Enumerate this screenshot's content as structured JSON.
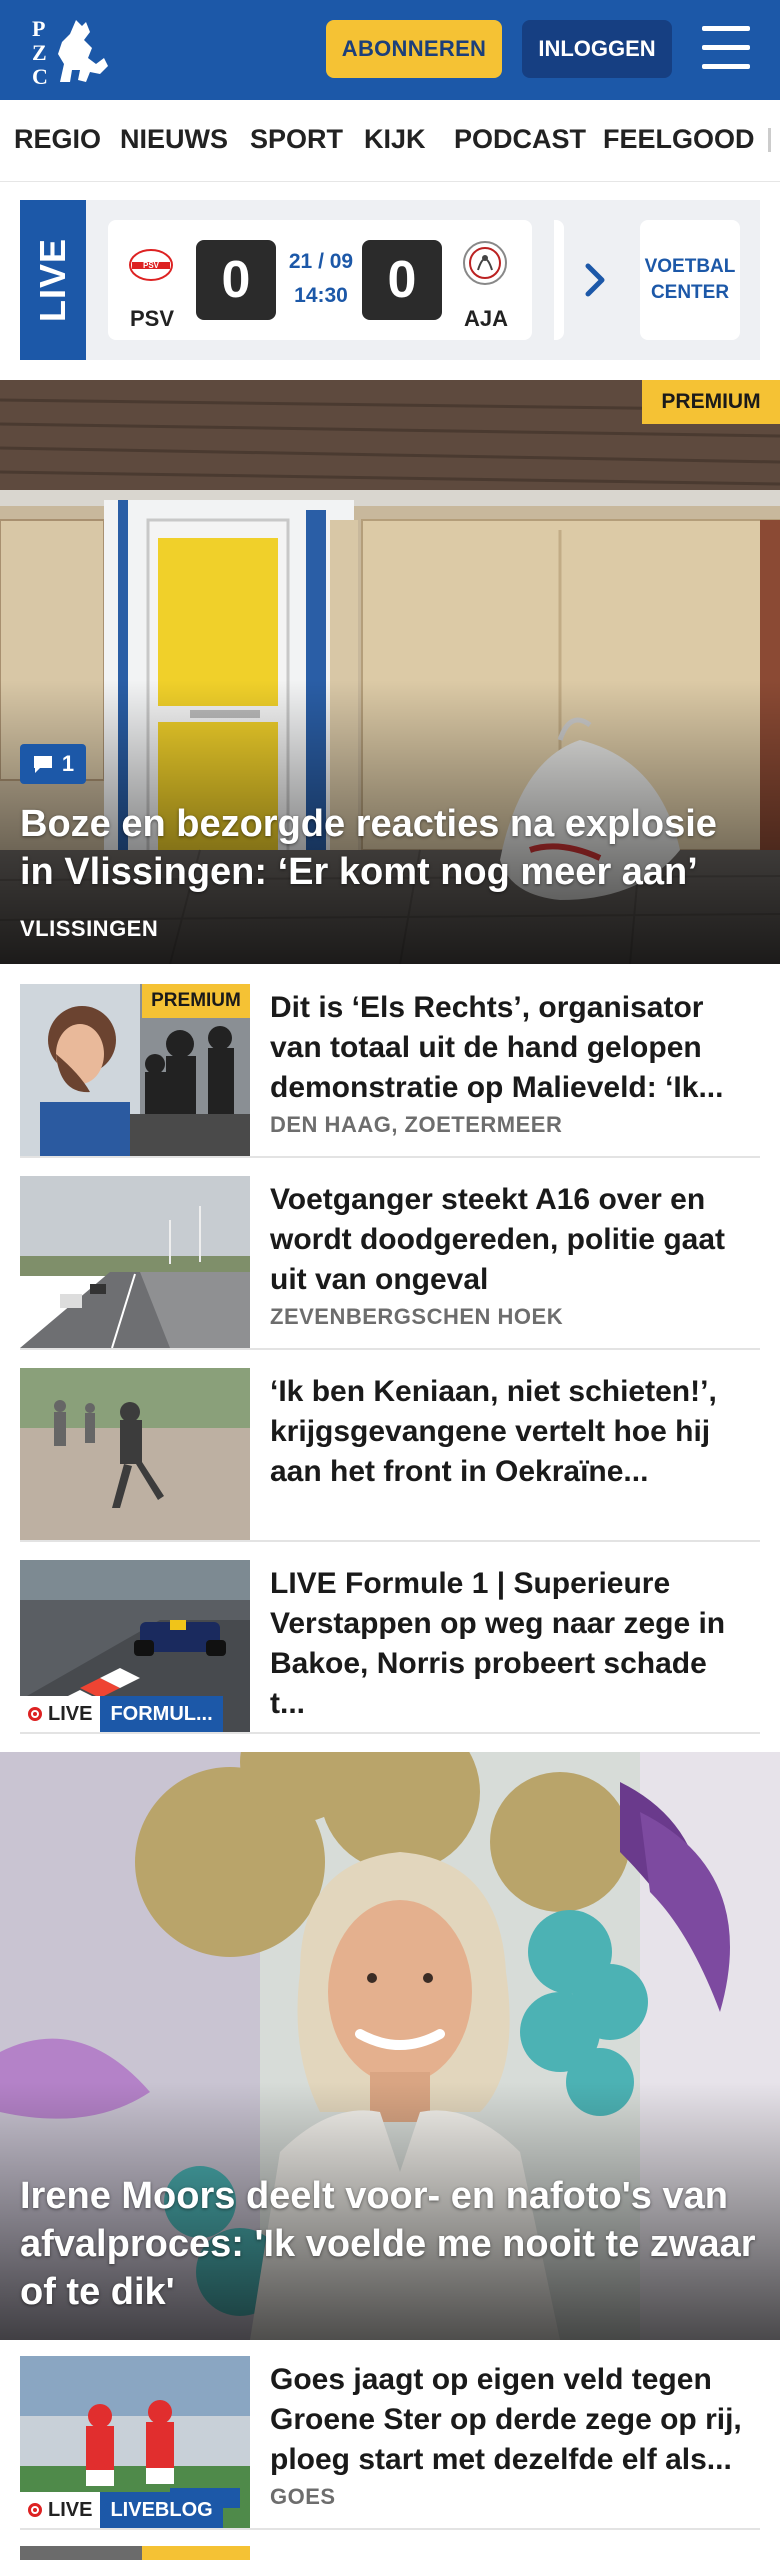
{
  "header": {
    "logo_text": "PZC",
    "subscribe_label": "ABONNEREN",
    "login_label": "INLOGGEN"
  },
  "nav": {
    "items": [
      "REGIO",
      "NIEUWS",
      "SPORT",
      "KIJK",
      "PODCAST",
      "FEELGOOD"
    ]
  },
  "live_strip": {
    "live_label": "LIVE",
    "match": {
      "home_team": "PSV",
      "away_team": "AJA",
      "home_score": "0",
      "away_score": "0",
      "date": "21 / 09",
      "time": "14:30"
    },
    "voetbal_center_label": "VOETBAL CENTER"
  },
  "hero": {
    "premium_label": "PREMIUM",
    "comment_count": "1",
    "title": "Boze en bezorgde reacties na explosie in Vlissingen: ‘Er komt nog meer aan’",
    "location": "VLISSINGEN"
  },
  "articles": [
    {
      "premium_label": "PREMIUM",
      "title": "Dit is ‘Els Rechts’, organisator van totaal uit de hand gelopen demonstratie op Malieveld: ‘Ik...",
      "location": "DEN HAAG, ZOETERMEER"
    },
    {
      "title": "Voetganger steekt A16 over en wordt doodgereden, politie gaat uit van ongeval",
      "location": "ZEVENBERGSCHEN HOEK"
    },
    {
      "title": "‘Ik ben Keniaan, niet schieten!’, krijgsgevangene vertelt hoe hij aan het front in Oekraïne..."
    },
    {
      "title": "LIVE Formule 1 | Superieure Verstappen op weg naar zege in Bakoe, Norris probeert schade t...",
      "live_label": "LIVE",
      "category_label": "FORMUL..."
    }
  ],
  "feature": {
    "title": "Irene Moors deelt voor- en nafoto's van afvalproces: 'Ik voelde me nooit te zwaar of te dik'"
  },
  "last_article": {
    "title": "Goes jaagt op eigen veld tegen Groene Ster op derde zege op rij, ploeg start met dezelfde elf als...",
    "location": "GOES",
    "live_label": "LIVE",
    "category_label": "LIVEBLOG"
  },
  "colors": {
    "brand_blue": "#1c58a8",
    "login_blue": "#163f82",
    "accent_yellow": "#f5c234",
    "live_red": "#dd2222"
  },
  "icons": {
    "menu": "hamburger-icon",
    "comment": "speech-bubble-icon",
    "arrow": "chevron-right-icon",
    "live": "record-dot-icon"
  }
}
